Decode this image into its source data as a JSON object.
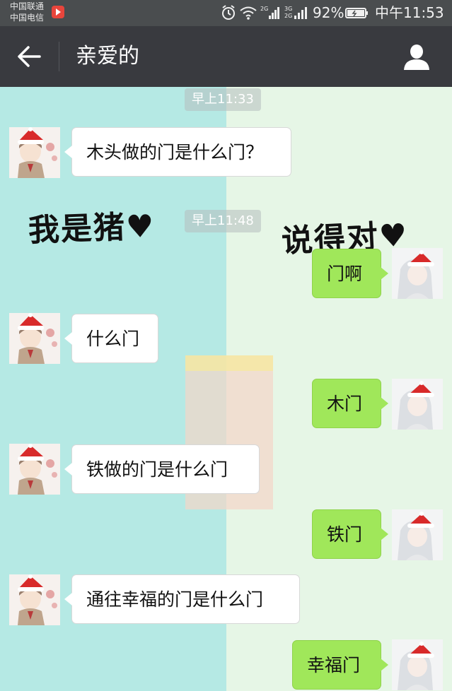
{
  "status_bar": {
    "carrier_1": "中国联通",
    "carrier_2": "中国电信",
    "battery_percent": "92%",
    "time": "中午11:53",
    "signal_1_label": "2G",
    "signal_2_label": "3G 2G",
    "icons": [
      "app-notification-icon",
      "alarm-icon",
      "wifi-icon",
      "signal-icon",
      "battery-icon"
    ]
  },
  "header": {
    "title": "亲爱的",
    "back_icon": "arrow-left-icon",
    "profile_icon": "person-icon",
    "background_color": "#393a3f"
  },
  "chat_background": {
    "left_text": "我是猪♥",
    "right_text": "说得对♥",
    "left_color": "#b5e9e4",
    "right_color": "#e6f6e6"
  },
  "timestamps": [
    "早上11:33",
    "早上11:48"
  ],
  "messages": [
    {
      "from": "contact",
      "text": "木头做的门是什么门？"
    },
    {
      "from": "me",
      "text": "门啊"
    },
    {
      "from": "contact",
      "text": "什么门"
    },
    {
      "from": "me",
      "text": "木门"
    },
    {
      "from": "contact",
      "text": "铁做的门是什么门"
    },
    {
      "from": "me",
      "text": "铁门"
    },
    {
      "from": "contact",
      "text": "通往幸福的门是什么门"
    },
    {
      "from": "me",
      "text": "幸福门"
    }
  ],
  "colors": {
    "outgoing_bubble": "#a0e75a",
    "incoming_bubble": "#ffffff"
  }
}
